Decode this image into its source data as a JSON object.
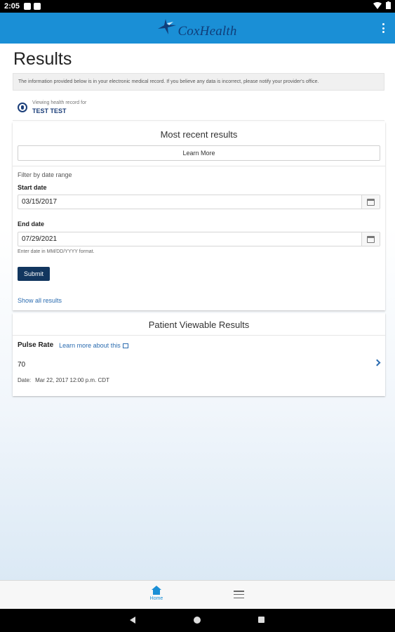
{
  "status_bar": {
    "time": "2:05"
  },
  "header": {
    "logo_text": "CoxHealth"
  },
  "page": {
    "title": "Results",
    "notice": "The information provided below is in your electronic medical record. If you believe any data is incorrect, please notify your provider's office."
  },
  "viewing": {
    "label": "Viewing health record for",
    "name": "TEST TEST"
  },
  "recent": {
    "title": "Most recent results",
    "learn_more": "Learn More",
    "filter_label": "Filter by date range",
    "start_label": "Start date",
    "start_value": "03/15/2017",
    "end_label": "End date",
    "end_value": "07/29/2021",
    "hint": "Enter date in MM/DD/YYYY format.",
    "submit": "Submit",
    "show_all": "Show all results"
  },
  "viewable": {
    "title": "Patient Viewable Results",
    "item": {
      "name": "Pulse Rate",
      "learn_link": "Learn more about this",
      "value": "70",
      "date_label": "Date:",
      "date_value": "Mar 22, 2017 12:00 p.m. CDT"
    }
  },
  "bottom_nav": {
    "home_label": "Home"
  },
  "colors": {
    "header_blue": "#1a8fd6",
    "navy": "#12365f",
    "link": "#2b6cb0"
  },
  "icons": [
    "wifi-icon",
    "battery-icon",
    "kebab-menu-icon",
    "person-icon",
    "calendar-icon",
    "external-link-icon",
    "chevron-right-icon",
    "home-icon",
    "hamburger-menu-icon"
  ]
}
